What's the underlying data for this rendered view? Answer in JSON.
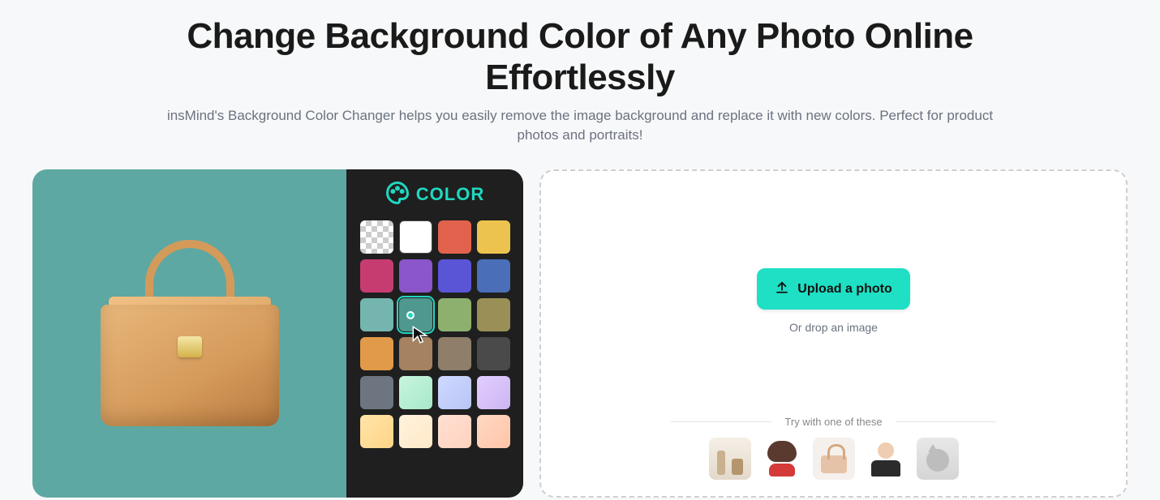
{
  "hero": {
    "title": "Change Background Color of Any Photo Online Effortlessly",
    "subtitle": "insMind's Background Color Changer helps you easily remove the image background and replace it with new colors. Perfect for product photos and portraits!"
  },
  "palette": {
    "label": "COLOR",
    "selected_index": 9,
    "swatches": [
      {
        "name": "transparent",
        "value": "transparent"
      },
      {
        "name": "white",
        "value": "#ffffff"
      },
      {
        "name": "coral",
        "value": "#e2624d"
      },
      {
        "name": "gold",
        "value": "#ecc34f"
      },
      {
        "name": "magenta",
        "value": "#c63c71"
      },
      {
        "name": "purple",
        "value": "#8a56c9"
      },
      {
        "name": "indigo",
        "value": "#5a55d6"
      },
      {
        "name": "blue",
        "value": "#4a6fb8"
      },
      {
        "name": "teal-light",
        "value": "#74b5b0"
      },
      {
        "name": "teal",
        "value": "#4f9890"
      },
      {
        "name": "sage",
        "value": "#8db06e"
      },
      {
        "name": "olive",
        "value": "#9a8f56"
      },
      {
        "name": "orange",
        "value": "#e09a4a"
      },
      {
        "name": "brown",
        "value": "#a58260"
      },
      {
        "name": "taupe",
        "value": "#8e7e6a"
      },
      {
        "name": "charcoal",
        "value": "#4a4a4a"
      },
      {
        "name": "slate",
        "value": "#6d7680"
      },
      {
        "name": "mint-gradient",
        "value": "linear-gradient(135deg,#c7f5dd,#a8e8c8)"
      },
      {
        "name": "sky-gradient",
        "value": "linear-gradient(135deg,#cfd9ff,#b8c5f5)"
      },
      {
        "name": "lilac-gradient",
        "value": "linear-gradient(135deg,#e2ceff,#cdb5f2)"
      },
      {
        "name": "sunrise-gradient",
        "value": "linear-gradient(135deg,#ffe5a8,#ffd488)"
      },
      {
        "name": "cream-gradient",
        "value": "linear-gradient(135deg,#fff2dd,#ffe9c8)"
      },
      {
        "name": "blush-gradient",
        "value": "linear-gradient(135deg,#ffe0d2,#ffd2bf)"
      },
      {
        "name": "peach-gradient",
        "value": "linear-gradient(135deg,#ffd8c2,#ffc5a8)"
      }
    ]
  },
  "upload": {
    "button_label": "Upload a photo",
    "drop_label": "Or drop an image"
  },
  "samples": {
    "label": "Try with one of these",
    "items": [
      {
        "name": "cosmetics"
      },
      {
        "name": "woman-red-lipstick"
      },
      {
        "name": "tan-handbag"
      },
      {
        "name": "business-woman"
      },
      {
        "name": "gray-cat"
      }
    ]
  },
  "preview": {
    "background_color": "#5ea8a3",
    "product": "tan-handbag"
  }
}
